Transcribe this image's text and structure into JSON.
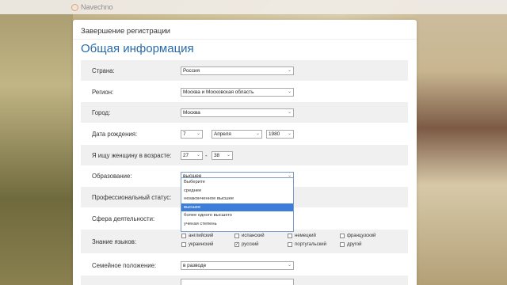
{
  "logo": {
    "text": "Navechno"
  },
  "page": {
    "registration_title": "Завершение регистрации",
    "section_title": "Общая информация"
  },
  "form": {
    "country": {
      "label": "Страна:",
      "value": "Россия"
    },
    "region": {
      "label": "Регион:",
      "value": "Москва и Московская область"
    },
    "city": {
      "label": "Город:",
      "value": "Москва"
    },
    "birthdate": {
      "label": "Дата рождения:",
      "day": "7",
      "month": "Апреля",
      "year": "1980"
    },
    "seeking": {
      "label": "Я ищу женщину в возрасте:",
      "from": "27",
      "separator": "-",
      "to": "38"
    },
    "education": {
      "label": "Образование:",
      "value": "высшее",
      "options": [
        "Выберите",
        "среднее",
        "незаконченное высшее",
        "высшее",
        "более одного высшего",
        "ученая степень"
      ],
      "selected_index": 3
    },
    "professional_status": {
      "label": "Профессиональный статус:"
    },
    "field_of_activity": {
      "label": "Сфера деятельности:"
    },
    "languages": {
      "label": "Знание языков:",
      "items": [
        {
          "name": "английский",
          "checked": false
        },
        {
          "name": "испанский",
          "checked": false
        },
        {
          "name": "немецкий",
          "checked": false
        },
        {
          "name": "французский",
          "checked": false
        },
        {
          "name": "украинский",
          "checked": false
        },
        {
          "name": "русский",
          "checked": true
        },
        {
          "name": "португальский",
          "checked": false
        },
        {
          "name": "другой",
          "checked": false
        }
      ]
    },
    "marital_status": {
      "label": "Семейное положение:",
      "value": "в разводе"
    }
  }
}
